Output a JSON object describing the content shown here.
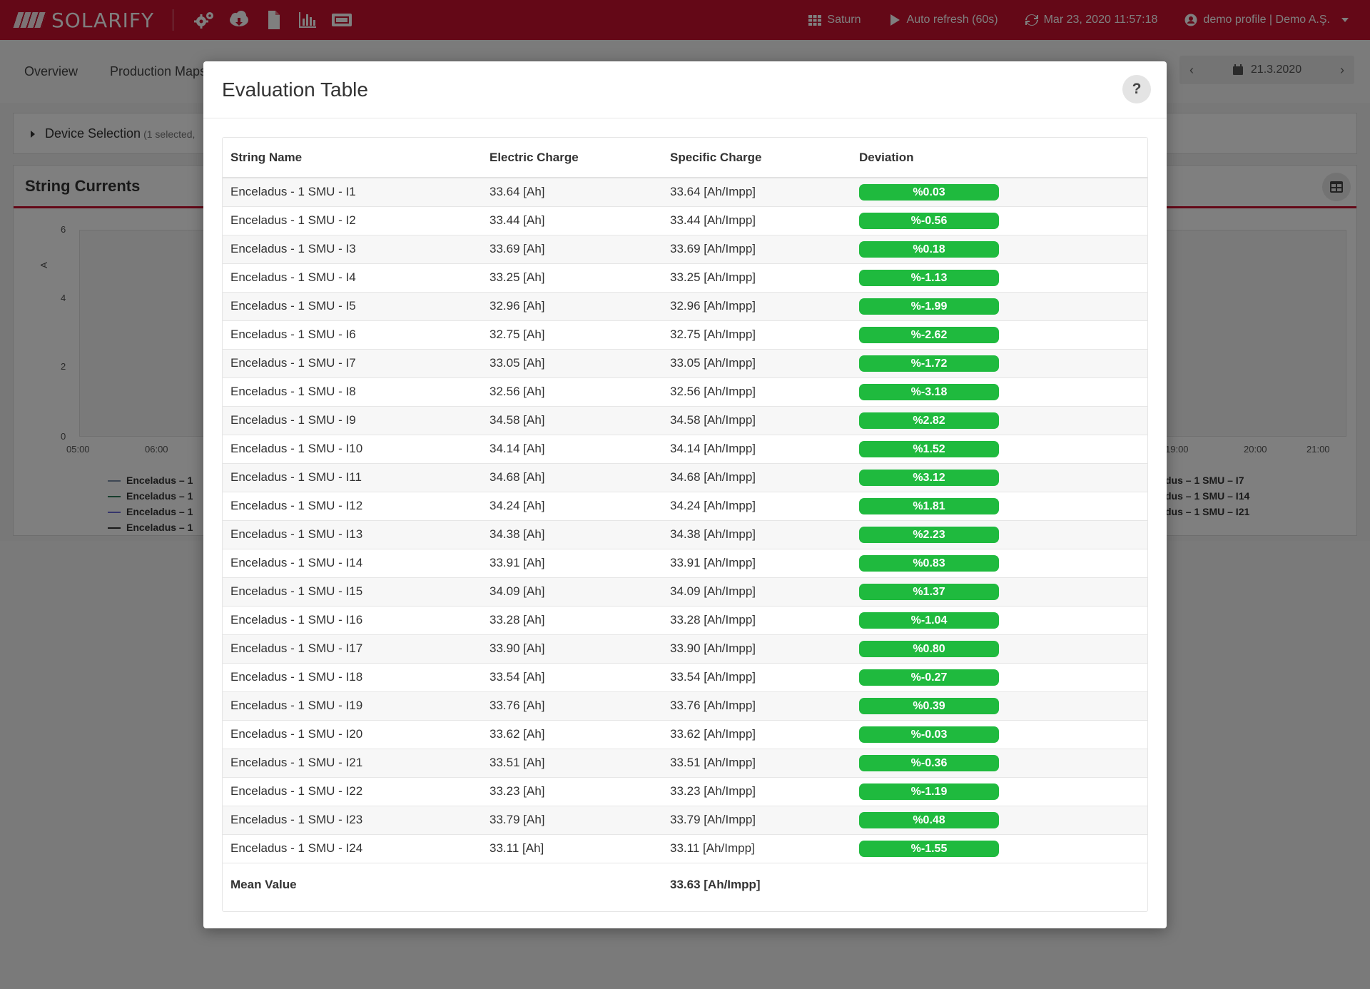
{
  "app": {
    "logo_text": "SOLARIFY",
    "plant": "Saturn",
    "auto_refresh": "Auto refresh (60s)",
    "timestamp": "Mar 23, 2020 11:57:18",
    "profile": "demo profile | Demo A.Ş."
  },
  "page": {
    "tabs": [
      "Overview",
      "Production Maps"
    ],
    "date_value": "21.3.2020",
    "device_selection": "Device Selection",
    "device_selection_count": "(1 selected,",
    "chart_title": "String Currents",
    "chart": {
      "y_label": "A",
      "y_ticks": [
        "6",
        "4",
        "2",
        "0"
      ],
      "x_ticks_left": [
        "05:00",
        "06:00"
      ],
      "x_ticks_right": [
        "19:00",
        "20:00",
        "21:00"
      ],
      "legend_left": [
        "Enceladus – 1",
        "Enceladus – 1",
        "Enceladus – 1",
        "Enceladus – 1"
      ],
      "legend_right": [
        "dus – 1 SMU – I7",
        "dus – 1 SMU – I14",
        "dus – 1 SMU – I21"
      ],
      "colors": [
        "#7a8fa8",
        "#2e7d5b",
        "#6a6ad8",
        "#333333"
      ]
    }
  },
  "modal": {
    "title": "Evaluation Table",
    "help_label": "?",
    "columns": [
      "String Name",
      "Electric Charge",
      "Specific Charge",
      "Deviation"
    ],
    "rows": [
      {
        "name": "Enceladus - 1 SMU - I1",
        "charge": "33.64 [Ah]",
        "specific": "33.64 [Ah/Impp]",
        "deviation": "%0.03"
      },
      {
        "name": "Enceladus - 1 SMU - I2",
        "charge": "33.44 [Ah]",
        "specific": "33.44 [Ah/Impp]",
        "deviation": "%-0.56"
      },
      {
        "name": "Enceladus - 1 SMU - I3",
        "charge": "33.69 [Ah]",
        "specific": "33.69 [Ah/Impp]",
        "deviation": "%0.18"
      },
      {
        "name": "Enceladus - 1 SMU - I4",
        "charge": "33.25 [Ah]",
        "specific": "33.25 [Ah/Impp]",
        "deviation": "%-1.13"
      },
      {
        "name": "Enceladus - 1 SMU - I5",
        "charge": "32.96 [Ah]",
        "specific": "32.96 [Ah/Impp]",
        "deviation": "%-1.99"
      },
      {
        "name": "Enceladus - 1 SMU - I6",
        "charge": "32.75 [Ah]",
        "specific": "32.75 [Ah/Impp]",
        "deviation": "%-2.62"
      },
      {
        "name": "Enceladus - 1 SMU - I7",
        "charge": "33.05 [Ah]",
        "specific": "33.05 [Ah/Impp]",
        "deviation": "%-1.72"
      },
      {
        "name": "Enceladus - 1 SMU - I8",
        "charge": "32.56 [Ah]",
        "specific": "32.56 [Ah/Impp]",
        "deviation": "%-3.18"
      },
      {
        "name": "Enceladus - 1 SMU - I9",
        "charge": "34.58 [Ah]",
        "specific": "34.58 [Ah/Impp]",
        "deviation": "%2.82"
      },
      {
        "name": "Enceladus - 1 SMU - I10",
        "charge": "34.14 [Ah]",
        "specific": "34.14 [Ah/Impp]",
        "deviation": "%1.52"
      },
      {
        "name": "Enceladus - 1 SMU - I11",
        "charge": "34.68 [Ah]",
        "specific": "34.68 [Ah/Impp]",
        "deviation": "%3.12"
      },
      {
        "name": "Enceladus - 1 SMU - I12",
        "charge": "34.24 [Ah]",
        "specific": "34.24 [Ah/Impp]",
        "deviation": "%1.81"
      },
      {
        "name": "Enceladus - 1 SMU - I13",
        "charge": "34.38 [Ah]",
        "specific": "34.38 [Ah/Impp]",
        "deviation": "%2.23"
      },
      {
        "name": "Enceladus - 1 SMU - I14",
        "charge": "33.91 [Ah]",
        "specific": "33.91 [Ah/Impp]",
        "deviation": "%0.83"
      },
      {
        "name": "Enceladus - 1 SMU - I15",
        "charge": "34.09 [Ah]",
        "specific": "34.09 [Ah/Impp]",
        "deviation": "%1.37"
      },
      {
        "name": "Enceladus - 1 SMU - I16",
        "charge": "33.28 [Ah]",
        "specific": "33.28 [Ah/Impp]",
        "deviation": "%-1.04"
      },
      {
        "name": "Enceladus - 1 SMU - I17",
        "charge": "33.90 [Ah]",
        "specific": "33.90 [Ah/Impp]",
        "deviation": "%0.80"
      },
      {
        "name": "Enceladus - 1 SMU - I18",
        "charge": "33.54 [Ah]",
        "specific": "33.54 [Ah/Impp]",
        "deviation": "%-0.27"
      },
      {
        "name": "Enceladus - 1 SMU - I19",
        "charge": "33.76 [Ah]",
        "specific": "33.76 [Ah/Impp]",
        "deviation": "%0.39"
      },
      {
        "name": "Enceladus - 1 SMU - I20",
        "charge": "33.62 [Ah]",
        "specific": "33.62 [Ah/Impp]",
        "deviation": "%-0.03"
      },
      {
        "name": "Enceladus - 1 SMU - I21",
        "charge": "33.51 [Ah]",
        "specific": "33.51 [Ah/Impp]",
        "deviation": "%-0.36"
      },
      {
        "name": "Enceladus - 1 SMU - I22",
        "charge": "33.23 [Ah]",
        "specific": "33.23 [Ah/Impp]",
        "deviation": "%-1.19"
      },
      {
        "name": "Enceladus - 1 SMU - I23",
        "charge": "33.79 [Ah]",
        "specific": "33.79 [Ah/Impp]",
        "deviation": "%0.48"
      },
      {
        "name": "Enceladus - 1 SMU - I24",
        "charge": "33.11 [Ah]",
        "specific": "33.11 [Ah/Impp]",
        "deviation": "%-1.55"
      }
    ],
    "footer": {
      "label": "Mean Value",
      "specific": "33.63 [Ah/Impp]"
    },
    "badge_color": "#1fba3e"
  },
  "colors": {
    "brand": "#c8102e",
    "success": "#1fba3e"
  },
  "icons": [
    "solar-panel-logo-icon",
    "cogs-icon",
    "cloud-download-icon",
    "file-icon",
    "bar-chart-icon",
    "monitor-icon",
    "grid-icon",
    "play-icon",
    "refresh-icon",
    "user-circle-icon",
    "calendar-icon",
    "table-icon",
    "question-icon"
  ]
}
